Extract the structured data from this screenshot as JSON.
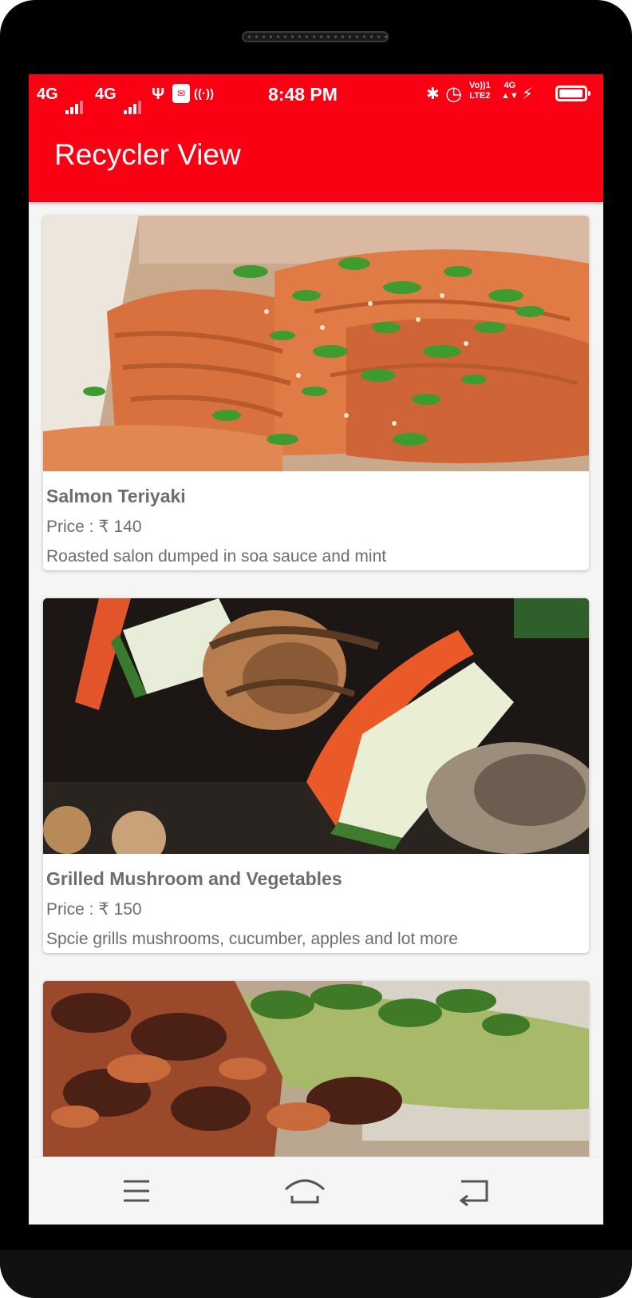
{
  "status_bar": {
    "network1": "4G",
    "network2": "4G",
    "time": "8:48 PM",
    "volte_top": "Vo))1",
    "volte_bottom": "LTE2",
    "network_right": "4G",
    "battery_level": 0.95
  },
  "app_bar": {
    "title": "Recycler View"
  },
  "items": [
    {
      "name": "Salmon Teriyaki",
      "price": "Price : ₹ 140",
      "description": "Roasted salon dumped in soa sauce and mint",
      "image_icon": "salmon-teriyaki-photo"
    },
    {
      "name": "Grilled Mushroom and Vegetables",
      "price": "Price : ₹ 150",
      "description": "Spcie grills mushrooms, cucumber, apples and lot more",
      "image_icon": "grilled-vegetables-photo"
    },
    {
      "name": "",
      "price": "",
      "description": "",
      "image_icon": "grilled-chicken-photo"
    }
  ],
  "nav_bar": {
    "menu_icon": "menu-icon",
    "home_icon": "home-icon",
    "back_icon": "back-icon"
  },
  "colors": {
    "primary": "#fb0013",
    "text_secondary": "#6d6d6d",
    "background": "#f5f5f5"
  }
}
